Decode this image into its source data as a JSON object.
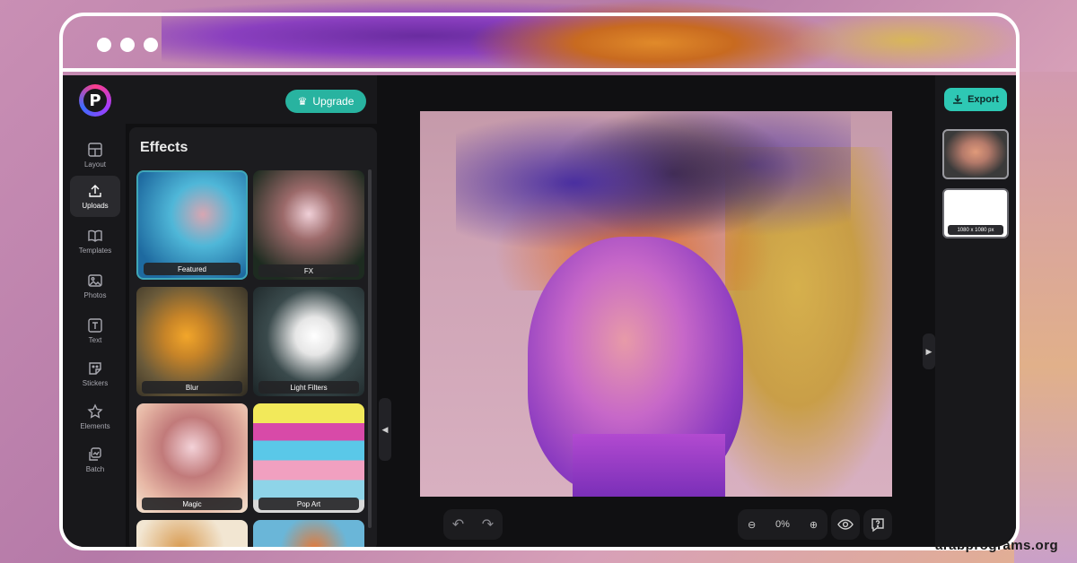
{
  "app": {
    "logo_letter": "P",
    "upgrade_label": "Upgrade",
    "export_label": "Export"
  },
  "rail": {
    "items": [
      {
        "label": "Layout",
        "icon": "layout-icon"
      },
      {
        "label": "Uploads",
        "icon": "upload-icon",
        "active": true
      },
      {
        "label": "Templates",
        "icon": "book-icon"
      },
      {
        "label": "Photos",
        "icon": "image-icon"
      },
      {
        "label": "Text",
        "icon": "text-icon"
      },
      {
        "label": "Stickers",
        "icon": "sticker-icon"
      },
      {
        "label": "Elements",
        "icon": "star-icon"
      },
      {
        "label": "Batch",
        "icon": "batch-icon"
      }
    ]
  },
  "effects": {
    "title": "Effects",
    "tiles": [
      {
        "label": "Featured"
      },
      {
        "label": "FX"
      },
      {
        "label": "Blur"
      },
      {
        "label": "Light Filters"
      },
      {
        "label": "Magic"
      },
      {
        "label": "Pop Art"
      }
    ]
  },
  "toolbar": {
    "zoom_value": "0%"
  },
  "pages": {
    "thumb2_label": "1080 x 1080 px"
  },
  "watermark": "arabprograms.org",
  "colors": {
    "accent": "#2ec8b4",
    "upgrade": "#28b3a0",
    "app_bg": "#101012"
  }
}
